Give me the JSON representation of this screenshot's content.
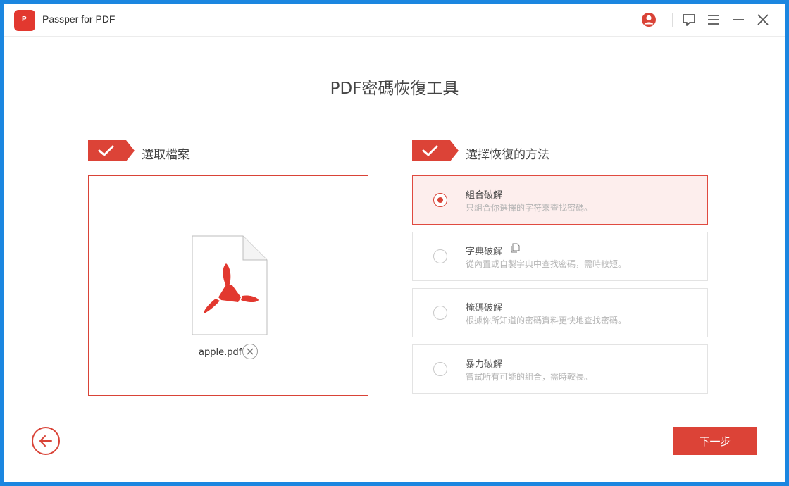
{
  "window": {
    "app_title": "Passper for PDF",
    "logo_glyph": "P"
  },
  "titlebar_icons": [
    "account-icon",
    "feedback-icon",
    "menu-icon",
    "minimize-icon",
    "close-icon"
  ],
  "main": {
    "page_title": "PDF密碼恢復工具"
  },
  "step1": {
    "label": "選取檔案",
    "file_name": "apple.pdf"
  },
  "step2": {
    "label": "選擇恢復的方法",
    "options": [
      {
        "title": "組合破解",
        "desc": "只組合你選擇的字符來查找密碼。",
        "selected": true
      },
      {
        "title": "字典破解",
        "desc": "從內置或自製字典中查找密碼，需時較短。",
        "selected": false
      },
      {
        "title": "掩碼破解",
        "desc": "根據你所知道的密碼資料更快地查找密碼。",
        "selected": false
      },
      {
        "title": "暴力破解",
        "desc": "嘗試所有可能的組合，需時較長。",
        "selected": false
      }
    ]
  },
  "footer": {
    "next_label": "下一步"
  },
  "colors": {
    "accent": "#dc4337",
    "selected_bg": "#fdeeed",
    "window_border": "#1b86e0"
  }
}
